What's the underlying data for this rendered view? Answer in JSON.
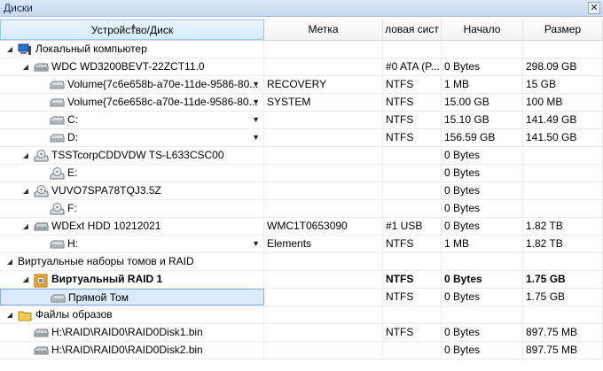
{
  "window": {
    "title": "Диски",
    "close_glyph": "✕"
  },
  "columns": [
    "Устройство/Диск",
    "Метка",
    "ловая сист",
    "Начало",
    "Размер"
  ],
  "rows": [
    {
      "level": 0,
      "expander": "open",
      "icon": "computer-icon",
      "name": "Локальный компьютер",
      "label": "",
      "fs": "",
      "start": "",
      "size": ""
    },
    {
      "level": 1,
      "expander": "open",
      "icon": "hard-disk-icon",
      "name": "WDC WD3200BEVT-22ZCT11.0",
      "label": "",
      "fs": "#0 ATA (P...",
      "start": "0 Bytes",
      "size": "298.09 GB"
    },
    {
      "level": 2,
      "expander": "none",
      "icon": "volume-icon",
      "name": "Volume{7c6e658b-a70e-11de-9586-80...",
      "dropdown": true,
      "label": "RECOVERY",
      "fs": "NTFS",
      "start": "1 MB",
      "size": "15 GB"
    },
    {
      "level": 2,
      "expander": "none",
      "icon": "volume-icon",
      "name": "Volume{7c6e658c-a70e-11de-9586-80...",
      "dropdown": true,
      "label": "SYSTEM",
      "fs": "NTFS",
      "start": "15.00 GB",
      "size": "100 MB"
    },
    {
      "level": 2,
      "expander": "none",
      "icon": "volume-icon",
      "name": "C:",
      "dropdown": true,
      "label": "",
      "fs": "NTFS",
      "start": "15.10 GB",
      "size": "141.49 GB"
    },
    {
      "level": 2,
      "expander": "none",
      "icon": "volume-icon",
      "name": "D:",
      "dropdown": true,
      "label": "",
      "fs": "NTFS",
      "start": "156.59 GB",
      "size": "141.50 GB"
    },
    {
      "level": 1,
      "expander": "open",
      "icon": "optical-drive-icon",
      "name": "TSSTcorpCDDVDW TS-L633CSC00",
      "label": "",
      "fs": "",
      "start": "0 Bytes",
      "size": ""
    },
    {
      "level": 2,
      "expander": "none",
      "icon": "optical-drive-icon",
      "name": "E:",
      "label": "",
      "fs": "",
      "start": "0 Bytes",
      "size": ""
    },
    {
      "level": 1,
      "expander": "open",
      "icon": "optical-drive-icon",
      "name": "VUVO7SPA78TQJ3.5Z",
      "label": "",
      "fs": "",
      "start": "0 Bytes",
      "size": ""
    },
    {
      "level": 2,
      "expander": "none",
      "icon": "optical-drive-icon",
      "name": "F:",
      "label": "",
      "fs": "",
      "start": "0 Bytes",
      "size": ""
    },
    {
      "level": 1,
      "expander": "open",
      "icon": "hard-disk-icon",
      "name": "WDExt HDD 10212021",
      "label": "WMC1T0653090",
      "fs": "#1 USB",
      "start": "0 Bytes",
      "size": "1.82 TB"
    },
    {
      "level": 2,
      "expander": "none",
      "icon": "volume-icon",
      "name": "H:",
      "dropdown": true,
      "label": "Elements",
      "fs": "NTFS",
      "start": "1 MB",
      "size": "1.82 TB"
    },
    {
      "level": 0,
      "expander": "open",
      "icon": "none",
      "name": "Виртуальные наборы томов и RAID",
      "label": "",
      "fs": "",
      "start": "",
      "size": ""
    },
    {
      "level": 1,
      "expander": "open",
      "icon": "raid-icon",
      "name": "Виртуальный RAID 1",
      "bold": true,
      "label": "",
      "fs": "NTFS",
      "start": "0 Bytes",
      "size": "1.75 GB"
    },
    {
      "level": 2,
      "expander": "none",
      "icon": "volume-icon",
      "name": "Прямой Том",
      "selected": true,
      "label": "",
      "fs": "NTFS",
      "start": "0 Bytes",
      "size": "1.75 GB"
    },
    {
      "level": 0,
      "expander": "open",
      "icon": "folder-icon",
      "name": "Файлы образов",
      "label": "",
      "fs": "",
      "start": "",
      "size": ""
    },
    {
      "level": 1,
      "expander": "none",
      "icon": "hard-disk-icon",
      "name": "H:\\RAID\\RAID0\\RAID0Disk1.bin",
      "label": "",
      "fs": "NTFS",
      "start": "0 Bytes",
      "size": "897.75 MB"
    },
    {
      "level": 1,
      "expander": "none",
      "icon": "hard-disk-icon",
      "name": "H:\\RAID\\RAID0\\RAID0Disk2.bin",
      "label": "",
      "fs": "",
      "start": "0 Bytes",
      "size": "897.75 MB"
    }
  ]
}
